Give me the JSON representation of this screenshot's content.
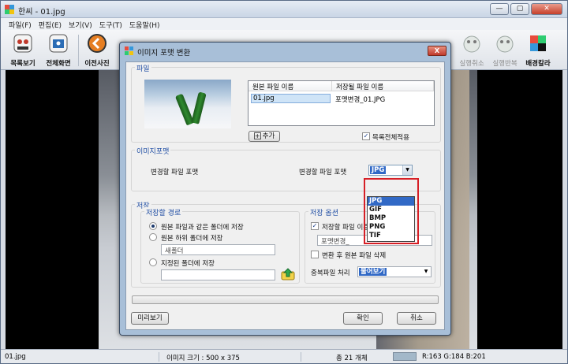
{
  "app": {
    "title": "한씨 - 01.jpg",
    "window_buttons": {
      "minimize": "—",
      "restore": "▢",
      "close": "✕"
    }
  },
  "menu": [
    "파일(F)",
    "편집(E)",
    "보기(V)",
    "도구(T)",
    "도움말(H)"
  ],
  "toolbar": {
    "items": [
      {
        "label": "목록보기",
        "icon": "list-view-icon",
        "color": "#c0392b"
      },
      {
        "label": "전체화면",
        "icon": "fullscreen-icon",
        "color": "#2c6db5"
      },
      {
        "label": "이전사진",
        "icon": "previous-photo-icon",
        "color": "#e67e22"
      },
      {
        "label": "실행취소",
        "icon": "undo-icon",
        "color": "#9aa5a0"
      },
      {
        "label": "실행반복",
        "icon": "redo-icon",
        "color": "#9aa5a0"
      },
      {
        "label": "배경칼라",
        "icon": "background-color-icon",
        "color": "#e74c3c"
      }
    ]
  },
  "dialog": {
    "title": "이미지 포맷 변환",
    "close": "X",
    "file_group": {
      "label": "파일",
      "columns": [
        "원본 파일 이름",
        "저장될 파일 이름"
      ],
      "rows": [
        {
          "source": "01.jpg",
          "target": "포맷변경_01.JPG"
        }
      ],
      "add_button": "추가",
      "add_icon": "+",
      "apply_all_checked": true,
      "apply_all_label": "목록전체적용"
    },
    "format_group": {
      "label": "이미지포맷",
      "source_format_label": "변경할 파일 포맷",
      "target_format_label": "변경할 파일 포맷",
      "selected_format": "JPG",
      "options": [
        "JPG",
        "GIF",
        "BMP",
        "PNG",
        "TIF"
      ]
    },
    "save_group": {
      "label": "저장",
      "path": {
        "label": "저장할 경로",
        "same_folder_label": "원본 파일과 같은 폴더에 저장",
        "subfolder_label": "원본 하위 폴더에 저장",
        "subfolder_value": "새폴더",
        "custom_folder_label": "지정된 폴더에 저장",
        "custom_folder_value": "",
        "selected": "same_folder"
      },
      "options": {
        "label": "저장 옵션",
        "prefix_checked": true,
        "prefix_label": "저장할 파일 이름 앞에 글 추가",
        "prefix_value": "포맷변경_",
        "delete_original_checked": false,
        "delete_original_label": "변환 후 원본 파일 삭제",
        "duplicate_label": "중복파일 처리",
        "duplicate_value": "물어보기"
      }
    },
    "buttons": {
      "preview": "미리보기",
      "ok": "확인",
      "cancel": "취소"
    }
  },
  "status": {
    "filename": "01.jpg",
    "image_size": "이미지 크기 : 500 x 375",
    "total": "총 21 개체",
    "rgb": "R:163 G:184 B:201",
    "sample_color": "#a3b8c9"
  }
}
